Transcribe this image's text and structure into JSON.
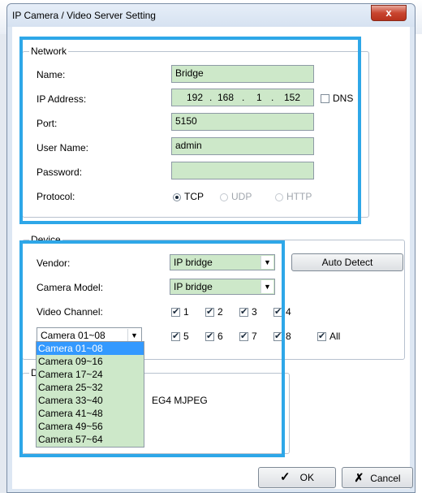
{
  "window": {
    "title": "IP Camera / Video Server Setting",
    "close_symbol": "x"
  },
  "network": {
    "legend": "Network",
    "name_label": "Name:",
    "name_value": "Bridge",
    "ip_label": "IP Address:",
    "ip_octets": [
      "192",
      "168",
      "1",
      "152"
    ],
    "dns_label": "DNS",
    "port_label": "Port:",
    "port_value": "5150",
    "user_label": "User Name:",
    "user_value": "admin",
    "password_label": "Password:",
    "password_value": "",
    "protocol_label": "Protocol:",
    "protocol_options": [
      "TCP",
      "UDP",
      "HTTP"
    ],
    "protocol_selected": "TCP"
  },
  "device": {
    "legend": "Device",
    "vendor_label": "Vendor:",
    "vendor_value": "IP bridge",
    "auto_detect_label": "Auto Detect",
    "model_label": "Camera Model:",
    "model_value": "IP bridge",
    "channel_label": "Video Channel:",
    "channels": [
      "1",
      "2",
      "3",
      "4",
      "5",
      "6",
      "7",
      "8"
    ],
    "all_label": "All",
    "camera_range_value": "Camera 01~08",
    "camera_range_options": [
      "Camera 01~08",
      "Camera 09~16",
      "Camera 17~24",
      "Camera 25~32",
      "Camera 33~40",
      "Camera 41~48",
      "Camera 49~56",
      "Camera 57~64"
    ]
  },
  "partial": {
    "legend_initial": "D",
    "codec_text": "EG4 MJPEG"
  },
  "buttons": {
    "ok_label": "OK",
    "cancel_label": "Cancel"
  },
  "colors": {
    "field_green": "#cde8c9",
    "highlight": "#2ea7e8",
    "selection": "#3399ff"
  }
}
